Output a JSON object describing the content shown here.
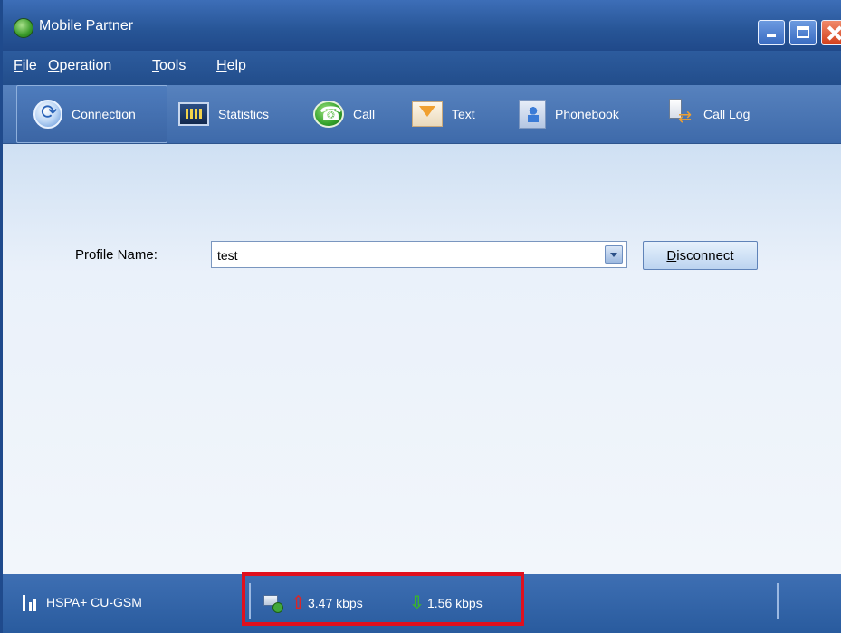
{
  "window": {
    "title": "Mobile Partner"
  },
  "menu": {
    "items": [
      "File",
      "Operation",
      "Tools",
      "Help"
    ]
  },
  "toolbar": {
    "items": [
      {
        "label": "Connection",
        "icon": "connection-icon",
        "active": true
      },
      {
        "label": "Statistics",
        "icon": "statistics-icon"
      },
      {
        "label": "Call",
        "icon": "call-icon"
      },
      {
        "label": "Text",
        "icon": "text-message-icon"
      },
      {
        "label": "Phonebook",
        "icon": "phonebook-icon"
      },
      {
        "label": "Call Log",
        "icon": "call-log-icon"
      }
    ]
  },
  "connection": {
    "profile_label": "Profile Name:",
    "profile_value": "test",
    "disconnect_label": "Disconnect"
  },
  "status": {
    "network": "HSPA+ CU-GSM",
    "upload": "3.47 kbps",
    "download": "1.56 kbps"
  },
  "colors": {
    "accent": "#295b9e",
    "highlight": "#e0101e",
    "upload_arrow": "#e02424",
    "download_arrow": "#3ab52c"
  }
}
